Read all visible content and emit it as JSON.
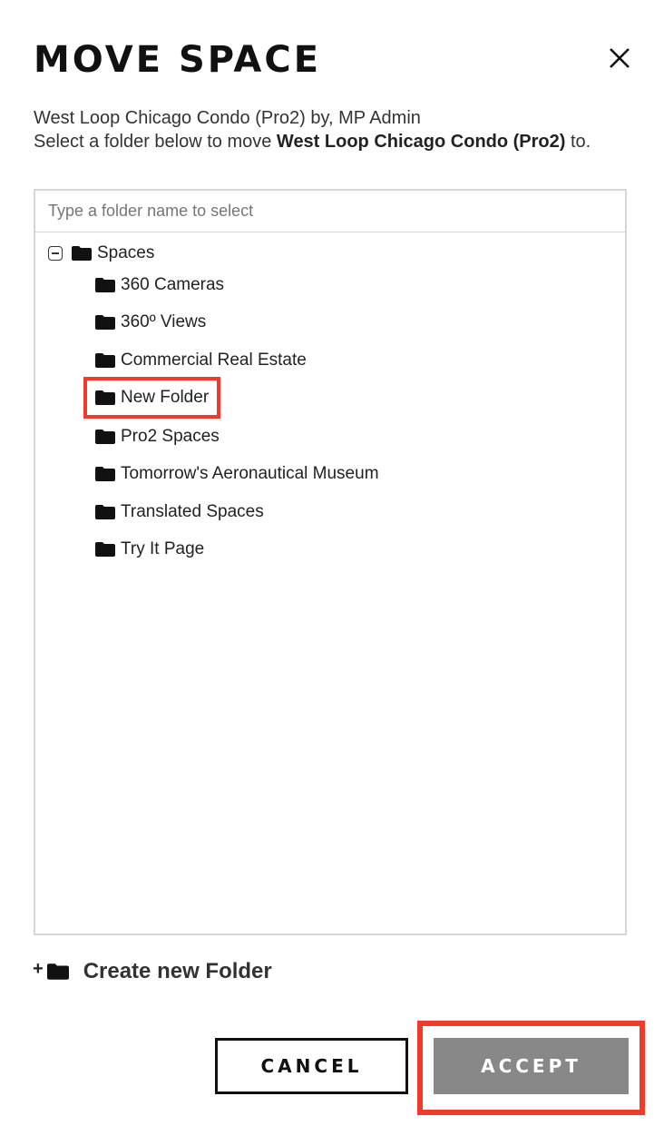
{
  "dialog": {
    "title": "MOVE SPACE",
    "close_icon": "close-icon",
    "description_line1": "West Loop Chicago Condo (Pro2) by, MP Admin",
    "description_prefix": "Select a folder below to move ",
    "space_name": "West Loop Chicago Condo (Pro2)",
    "description_suffix": " to."
  },
  "search": {
    "placeholder": "Type a folder name to select",
    "value": ""
  },
  "tree": {
    "root_label": "Spaces",
    "root_expanded": true,
    "folders": [
      {
        "label": "360 Cameras",
        "icon": "folder-icon"
      },
      {
        "label": "360º Views",
        "icon": "folder-icon"
      },
      {
        "label": "Commercial Real Estate",
        "icon": "folder-icon"
      },
      {
        "label": "New Folder",
        "icon": "folder-icon",
        "highlighted": true
      },
      {
        "label": "Pro2 Spaces",
        "icon": "folder-icon"
      },
      {
        "label": "Tomorrow's Aeronautical Museum",
        "icon": "folder-icon"
      },
      {
        "label": "Translated Spaces",
        "icon": "folder-icon"
      },
      {
        "label": "Try It Page",
        "icon": "folder-icon"
      }
    ]
  },
  "create_folder": {
    "plus": "+",
    "label": "Create new Folder"
  },
  "actions": {
    "cancel_label": "CANCEL",
    "accept_label": "ACCEPT"
  },
  "colors": {
    "highlight": "#f23a2a",
    "accept_bg": "#888888"
  }
}
